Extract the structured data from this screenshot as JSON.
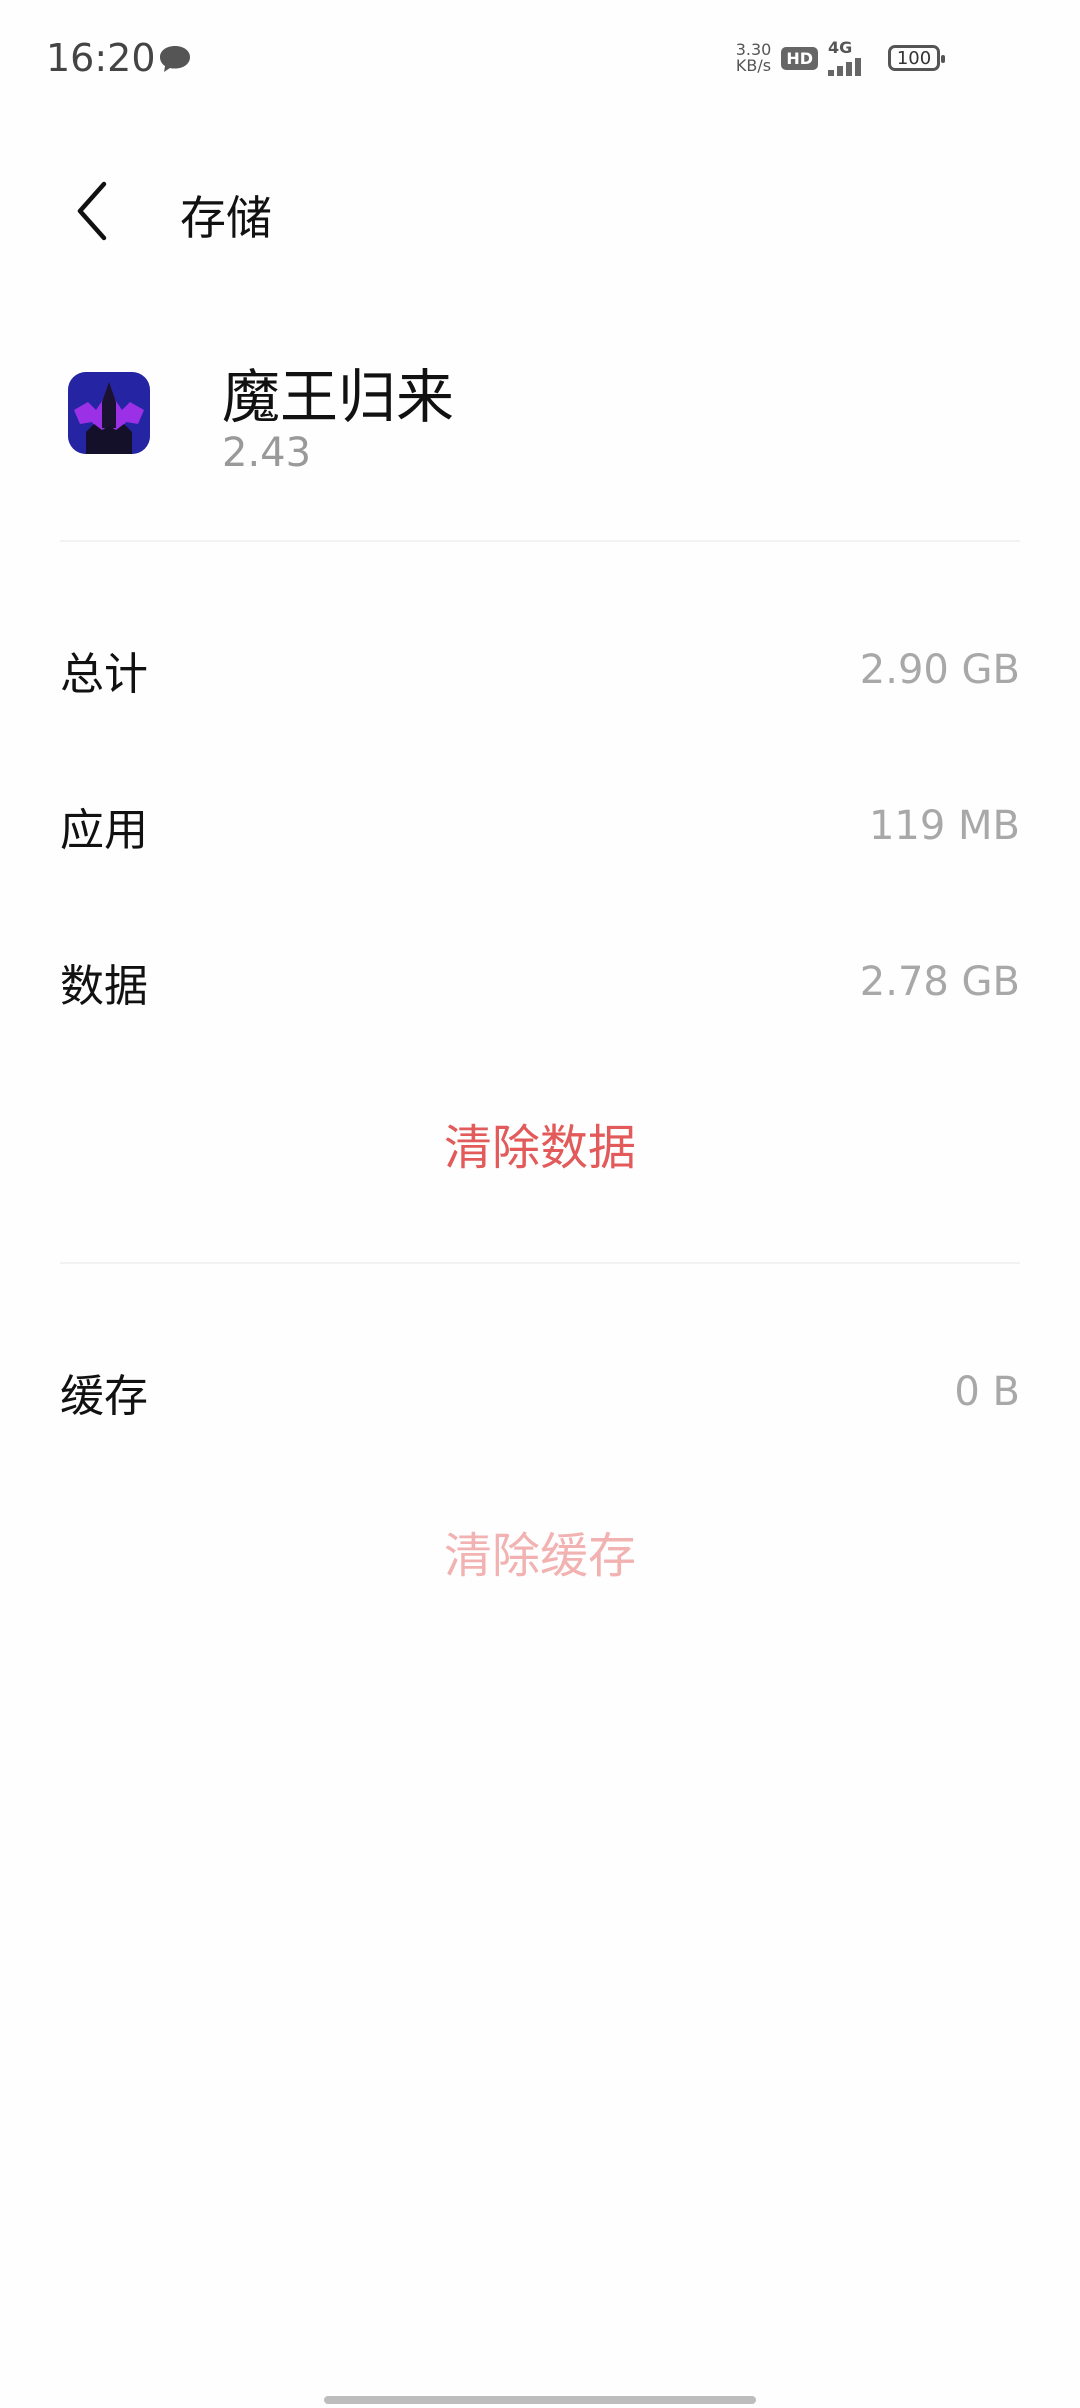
{
  "status_bar": {
    "time": "16:20",
    "net_speed_value": "3.30",
    "net_speed_unit": "KB/s",
    "hd_label": "HD",
    "network_label": "4G",
    "battery_level": "100",
    "icons": [
      "chat-bubble-icon",
      "hd-icon",
      "signal-icon",
      "battery-icon"
    ]
  },
  "header": {
    "title": "存储",
    "back_icon": "chevron-left-icon"
  },
  "app": {
    "name": "魔王归来",
    "version": "2.43",
    "icon": "app-icon"
  },
  "storage": {
    "total_label": "总计",
    "total_value": "2.90 GB",
    "app_label": "应用",
    "app_value": "119 MB",
    "data_label": "数据",
    "data_value": "2.78 GB",
    "clear_data_label": "清除数据",
    "cache_label": "缓存",
    "cache_value": "0 B",
    "clear_cache_label": "清除缓存"
  },
  "colors": {
    "accent_red": "#e25a5a",
    "disabled_red": "#f2b2b2",
    "secondary_text": "#a8a8a8"
  }
}
